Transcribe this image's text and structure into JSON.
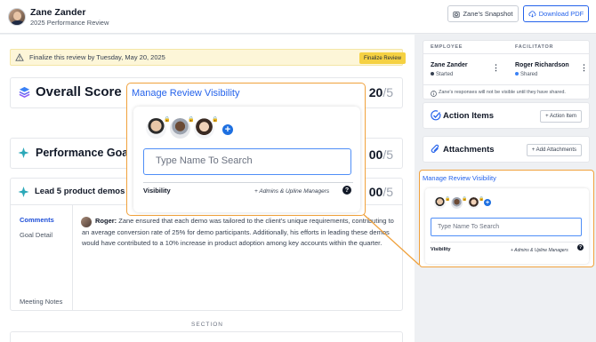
{
  "header": {
    "user_name": "Zane Zander",
    "review_name": "2025 Performance Review",
    "snapshot_label": "Zane's Snapshot",
    "download_label": "Download PDF"
  },
  "banner": {
    "text": "Finalize this review by Tuesday, May 20, 2025",
    "button_label": "Finalize Review"
  },
  "overall": {
    "title": "Overall Score",
    "score": "20",
    "out_of": "/5"
  },
  "goals": {
    "title": "Performance Goa",
    "score": "00",
    "out_of": "/5"
  },
  "goal_item": {
    "title": "Lead 5 product demos p",
    "score": "00",
    "out_of": "/5",
    "tabs": [
      "Comments",
      "Goal Detail",
      "Meeting Notes"
    ],
    "comment_author": "Roger:",
    "comment_text": " Zane ensured that each demo was tailored to the client's unique requirements, contributing to an average conversion rate of 25% for demo participants. Additionally, his efforts in leading these demos would have contributed to a 10% increase in product adoption among key accounts within the quarter."
  },
  "section_label": "SECTION",
  "sidebar": {
    "employee_header": "EMPLOYEE",
    "facilitator_header": "FACILITATOR",
    "employee_name": "Zane Zander",
    "employee_status": "Started",
    "facilitator_name": "Roger Richardson",
    "facilitator_status": "Shared",
    "note": "Zane's responses will not be visible until they have shared.",
    "action_items_title": "Action Items",
    "action_items_button": "+ Action Item",
    "attachments_title": "Attachments",
    "attachments_button": "+ Add Attachments",
    "colors": {
      "started": "#374151",
      "shared": "#3b82f6"
    }
  },
  "visibility_panel": {
    "title": "Manage Review Visibility",
    "search_placeholder": "Type Name To Search",
    "visibility_label": "Visibility",
    "visibility_value": "+ Admins & Upline Managers",
    "help_glyph": "?",
    "add_glyph": "+",
    "avatars": [
      "avatar-1",
      "avatar-2",
      "avatar-3"
    ],
    "highlight_color": "#f0a13c",
    "accent_color": "#2563eb"
  }
}
